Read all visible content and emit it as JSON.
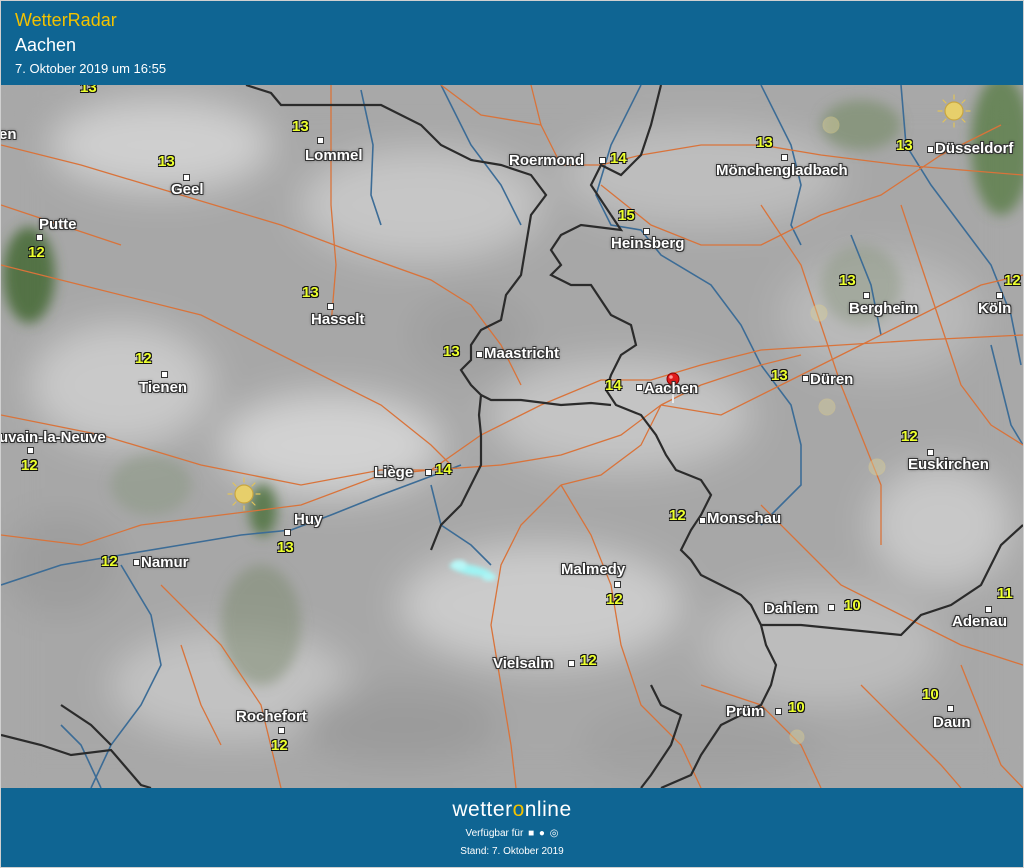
{
  "header": {
    "title": "WetterRadar",
    "place": "Aachen",
    "date": "7. Oktober 2019 um 16:55"
  },
  "footer": {
    "logo_a": "wetter",
    "logo_o": "o",
    "logo_b": "nline",
    "available": "Verfügbar für",
    "platform_icons": [
      "android-icon",
      "apple-icon",
      "web-icon"
    ],
    "stand": "Stand: 7. Oktober 2019"
  },
  "colors": {
    "header_bg": "#0f6593",
    "title": "#f2c200",
    "temperature": "#ecff2e",
    "road": "#d9733a",
    "river": "#3c6c96",
    "border": "#2b2b2b"
  },
  "map": {
    "cities": [
      {
        "id": "lommel",
        "name": "Lommel",
        "temp": "13"
      },
      {
        "id": "geel",
        "name": "Geel",
        "temp": "13"
      },
      {
        "id": "putte",
        "name": "Putte",
        "temp": "12"
      },
      {
        "id": "hasselt",
        "name": "Hasselt",
        "temp": "13"
      },
      {
        "id": "tienen",
        "name": "Tienen",
        "temp": "12"
      },
      {
        "id": "louvain",
        "name": "uvain-la-Neuve",
        "temp": "12"
      },
      {
        "id": "huy",
        "name": "Huy",
        "temp": "13"
      },
      {
        "id": "namur",
        "name": "Namur",
        "temp": "12"
      },
      {
        "id": "rochefort",
        "name": "Rochefort",
        "temp": "12"
      },
      {
        "id": "roermond",
        "name": "Roermond",
        "temp": "14"
      },
      {
        "id": "maastricht",
        "name": "Maastricht",
        "temp": "13"
      },
      {
        "id": "liege",
        "name": "Liège",
        "temp": "14"
      },
      {
        "id": "heinsberg",
        "name": "Heinsberg",
        "temp": "15"
      },
      {
        "id": "aachen",
        "name": "Aachen",
        "temp": "14"
      },
      {
        "id": "monschau",
        "name": "Monschau",
        "temp": "12"
      },
      {
        "id": "malmedy",
        "name": "Malmedy",
        "temp": "12"
      },
      {
        "id": "vielsalm",
        "name": "Vielsalm",
        "temp": "12"
      },
      {
        "id": "monchengladbach",
        "name": "Mönchengladbach",
        "temp": "13"
      },
      {
        "id": "dusseldorf",
        "name": "Düsseldorf",
        "temp": "13"
      },
      {
        "id": "bergheim",
        "name": "Bergheim",
        "temp": "13"
      },
      {
        "id": "koln",
        "name": "Köln",
        "temp": "12"
      },
      {
        "id": "duren",
        "name": "Düren",
        "temp": "13"
      },
      {
        "id": "euskirchen",
        "name": "Euskirchen",
        "temp": "12"
      },
      {
        "id": "dahlem",
        "name": "Dahlem",
        "temp": "10"
      },
      {
        "id": "adenau",
        "name": "Adenau",
        "temp": "11"
      },
      {
        "id": "prum",
        "name": "Prüm",
        "temp": "10"
      },
      {
        "id": "daun",
        "name": "Daun",
        "temp": "10"
      }
    ],
    "edge_labels": {
      "top_left_temp": "13",
      "left_fragment": "en"
    }
  }
}
